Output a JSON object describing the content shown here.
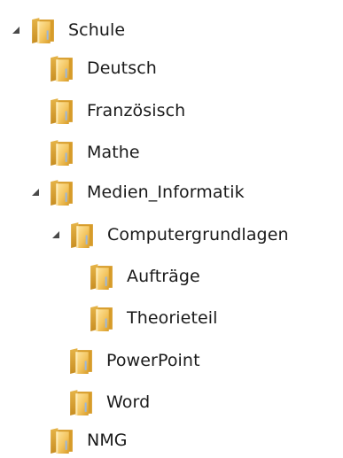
{
  "tree": {
    "root": {
      "label": "Schule",
      "state": "expanded",
      "icon": "folder-icon",
      "children": [
        {
          "label": "Deutsch",
          "icon": "folder-icon"
        },
        {
          "label": "Französisch",
          "icon": "folder-icon"
        },
        {
          "label": "Mathe",
          "icon": "folder-icon"
        },
        {
          "label": "Medien_Informatik",
          "state": "expanded",
          "icon": "folder-icon",
          "children": [
            {
              "label": "Computergrundlagen",
              "state": "expanded",
              "icon": "folder-icon",
              "children": [
                {
                  "label": "Aufträge",
                  "icon": "folder-icon"
                },
                {
                  "label": "Theorieteil",
                  "icon": "folder-icon"
                }
              ]
            },
            {
              "label": "PowerPoint",
              "icon": "folder-icon"
            },
            {
              "label": "Word",
              "icon": "folder-icon"
            }
          ]
        },
        {
          "label": "NMG",
          "icon": "folder-icon"
        }
      ]
    }
  },
  "colors": {
    "expander": "#4a4a4a",
    "folder_front": "#f2c15a",
    "folder_back": "#d9a12f",
    "folder_highlight": "#ffe39a",
    "label_text": "#1a1a1a"
  }
}
